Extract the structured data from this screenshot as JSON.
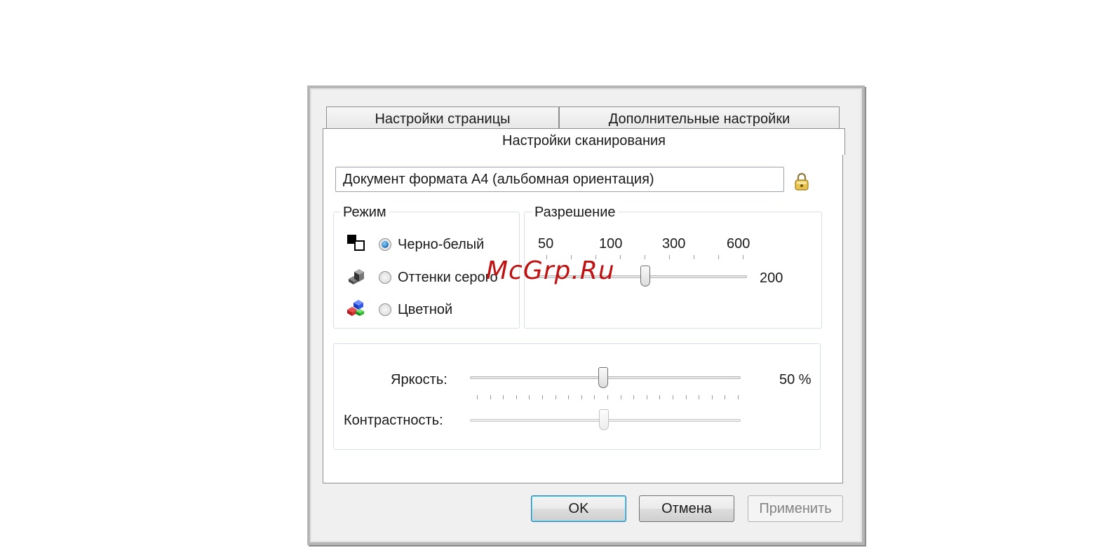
{
  "tabs": {
    "page_settings": "Настройки страницы",
    "advanced_settings": "Дополнительные настройки",
    "scan_settings": "Настройки сканирования"
  },
  "preset": {
    "value": "Документ формата A4 (альбомная ориентация)",
    "lock_icon": "lock-icon"
  },
  "mode": {
    "legend": "Режим",
    "options": [
      {
        "label": "Черно-белый",
        "icon": "black-white-icon",
        "checked": true
      },
      {
        "label": "Оттенки серого",
        "icon": "grayscale-icon",
        "checked": false
      },
      {
        "label": "Цветной",
        "icon": "color-icon",
        "checked": false
      }
    ]
  },
  "resolution": {
    "legend": "Разрешение",
    "scale_labels": [
      "50",
      "100",
      "300",
      "600"
    ],
    "value": "200"
  },
  "brightness": {
    "label": "Яркость:",
    "value": "50 %",
    "level_percent": 50
  },
  "contrast": {
    "label": "Контрастность:",
    "level_percent": 50,
    "enabled": false
  },
  "buttons": {
    "ok": "OK",
    "cancel": "Отмена",
    "apply": "Применить"
  },
  "watermark": "McGrp.Ru"
}
